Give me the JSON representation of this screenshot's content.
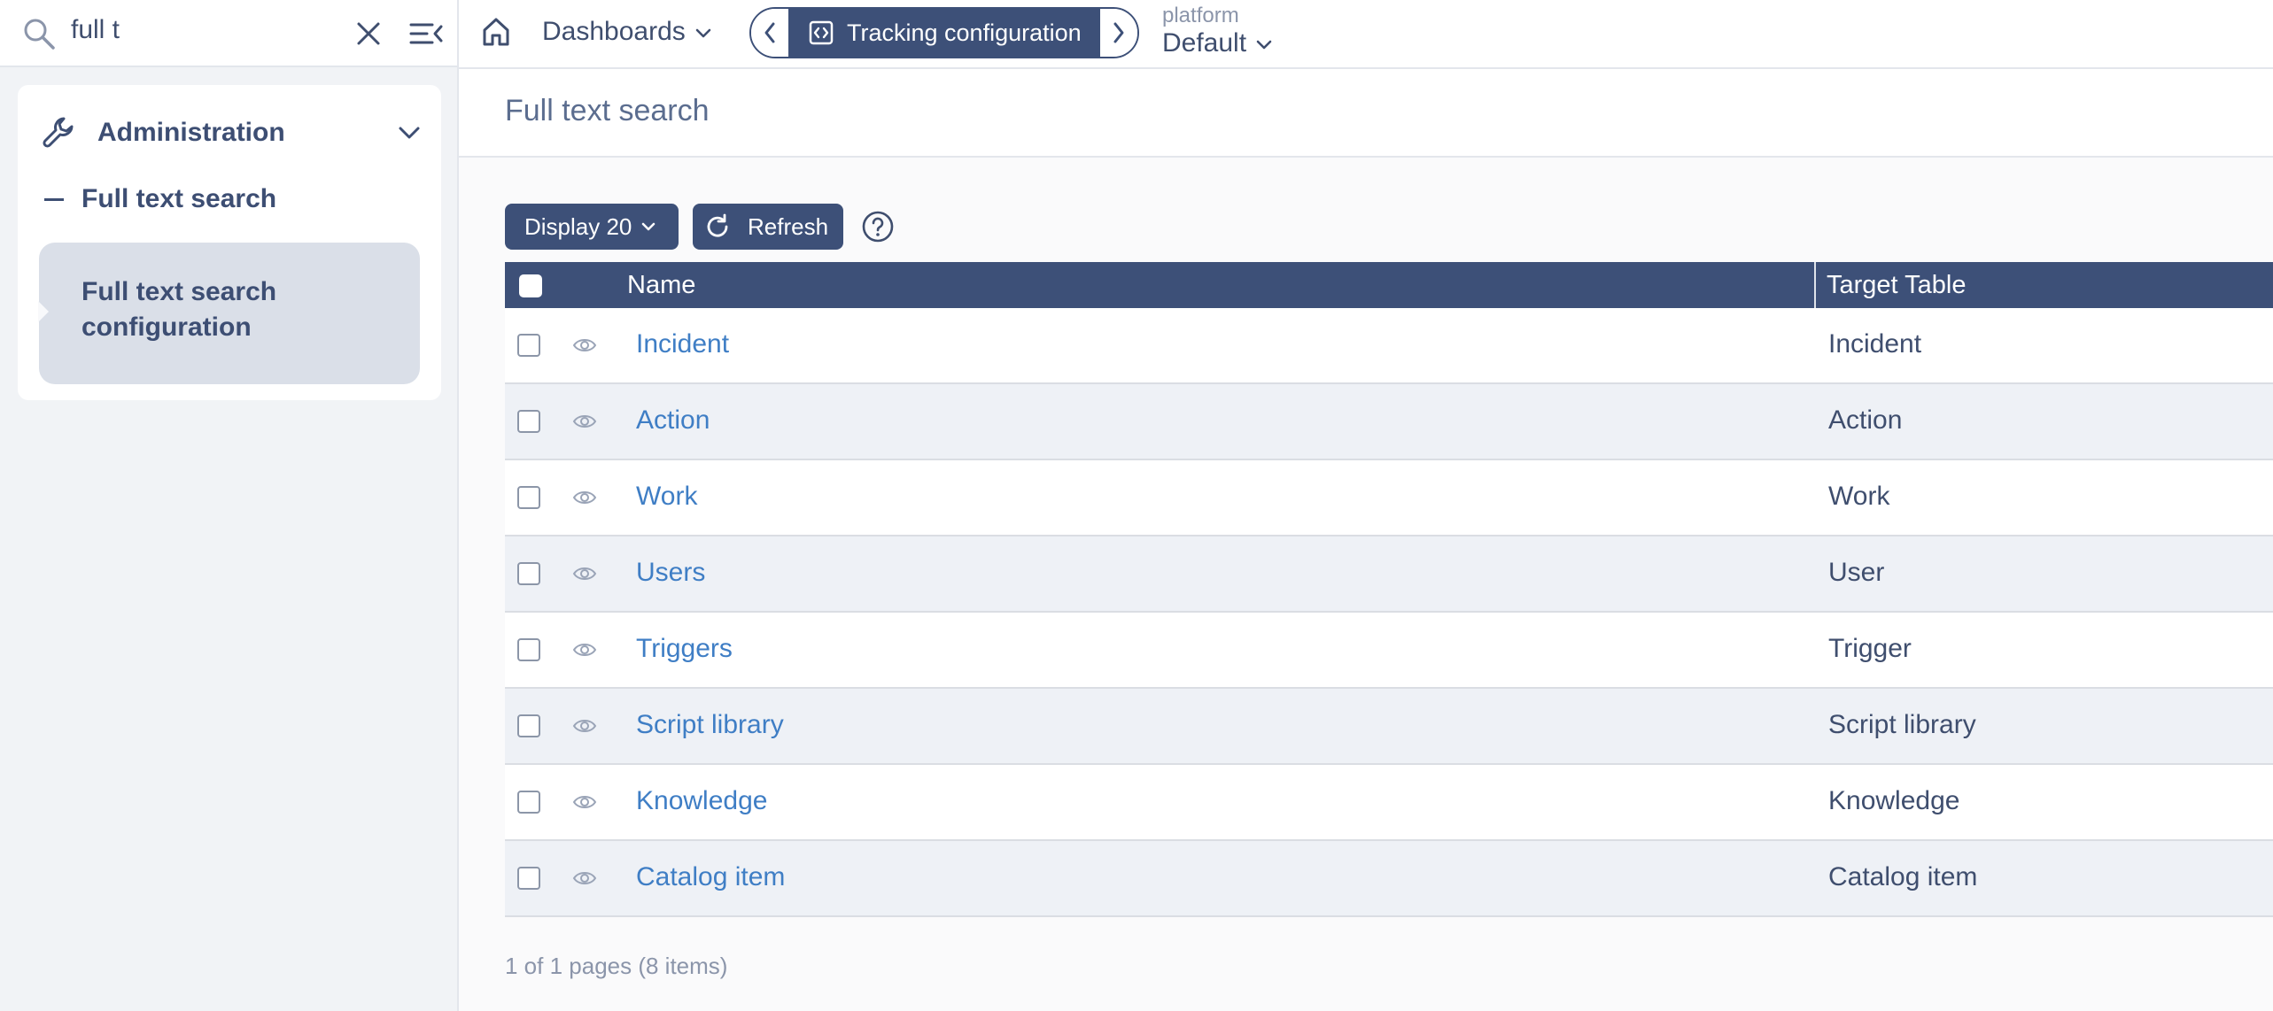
{
  "search": {
    "value": "full t"
  },
  "header": {
    "dashboards_label": "Dashboards",
    "active_tab_label": "Tracking configuration",
    "platform_label": "platform",
    "platform_value": "Default"
  },
  "sidebar": {
    "section_title": "Administration",
    "item_label": "Full text search",
    "subitem_label": "Full text search configuration"
  },
  "main": {
    "page_title": "Full text search",
    "display_label": "Display 20",
    "refresh_label": "Refresh",
    "columns": {
      "name": "Name",
      "target": "Target Table"
    },
    "rows": [
      {
        "name": "Incident",
        "target": "Incident"
      },
      {
        "name": "Action",
        "target": "Action"
      },
      {
        "name": "Work",
        "target": "Work"
      },
      {
        "name": "Users",
        "target": "User"
      },
      {
        "name": "Triggers",
        "target": "Trigger"
      },
      {
        "name": "Script library",
        "target": "Script library"
      },
      {
        "name": "Knowledge",
        "target": "Knowledge"
      },
      {
        "name": "Catalog item",
        "target": "Catalog item"
      }
    ],
    "pager_text": "1 of 1 pages (8 items)"
  },
  "colors": {
    "primary": "#3d5078",
    "link": "#3f7ec5",
    "row_alt": "#eef1f6",
    "sidebar_bg": "#f1f3f6"
  },
  "icons": [
    "search-icon",
    "clear-icon",
    "collapse-menu-icon",
    "home-icon",
    "chevron-down-icon",
    "chevron-left-icon",
    "chevron-right-icon",
    "code-frame-icon",
    "wrench-icon",
    "refresh-icon",
    "help-icon",
    "eye-icon"
  ]
}
